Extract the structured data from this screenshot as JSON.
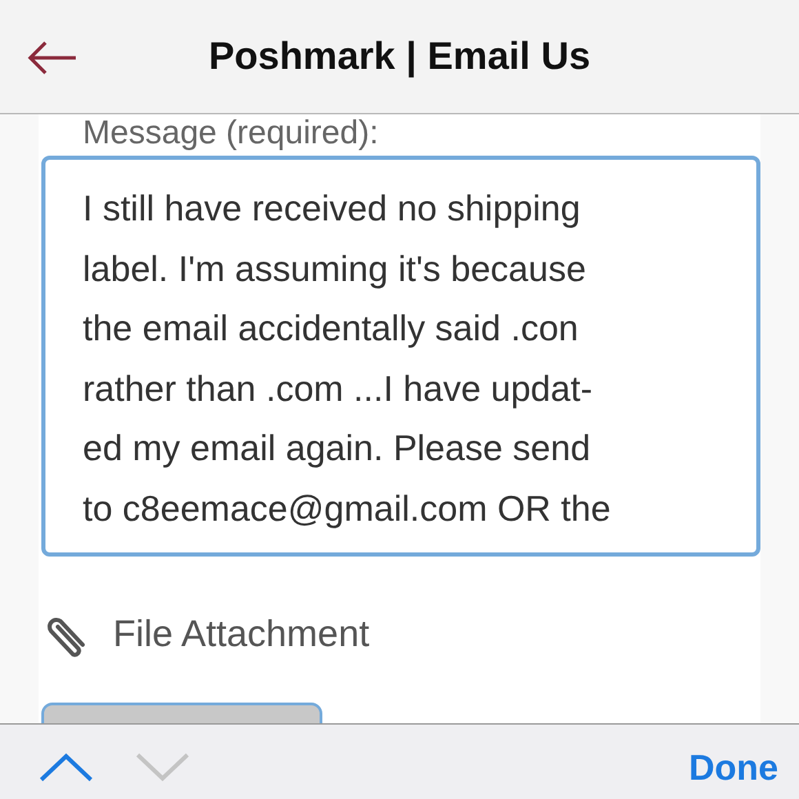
{
  "header": {
    "title": "Poshmark | Email Us"
  },
  "form": {
    "message_label": "Message (required):",
    "message_value": "I still have received no shipping\nlabel. I'm assuming it's because\nthe email accidentally said .con\nrather than .com ...I have updat-\ned my email again. Please send\nto c8eemace@gmail.com OR the",
    "focused": true,
    "attachment_label": "File Attachment"
  },
  "keyboard_toolbar": {
    "nav": [
      {
        "kind": "up",
        "disabled": false
      },
      {
        "kind": "down",
        "disabled": true
      }
    ],
    "done": "Done"
  }
}
